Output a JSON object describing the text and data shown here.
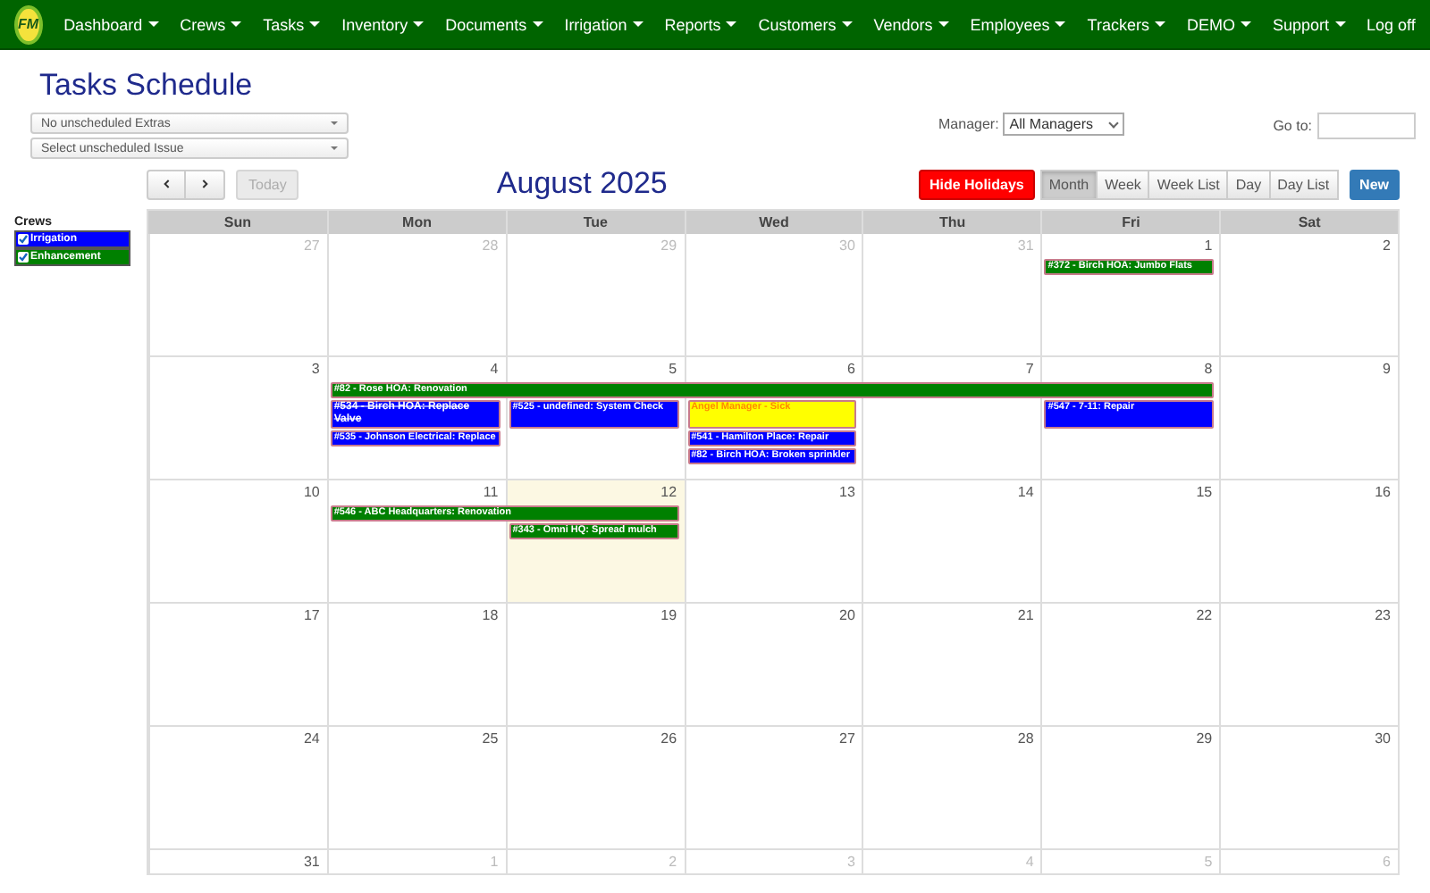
{
  "nav": {
    "logo": "FM",
    "items": [
      {
        "label": "Dashboard",
        "has_menu": true
      },
      {
        "label": "Crews",
        "has_menu": true
      },
      {
        "label": "Tasks",
        "has_menu": true
      },
      {
        "label": "Inventory",
        "has_menu": true
      },
      {
        "label": "Documents",
        "has_menu": true
      },
      {
        "label": "Irrigation",
        "has_menu": true
      },
      {
        "label": "Reports",
        "has_menu": true
      },
      {
        "label": "Customers",
        "has_menu": true
      },
      {
        "label": "Vendors",
        "has_menu": true
      },
      {
        "label": "Employees",
        "has_menu": true
      },
      {
        "label": "Trackers",
        "has_menu": true
      }
    ],
    "right_items": [
      {
        "label": "DEMO",
        "has_menu": true
      },
      {
        "label": "Support",
        "has_menu": true
      },
      {
        "label": "Log off",
        "has_menu": false
      }
    ]
  },
  "page": {
    "title": "Tasks Schedule",
    "dropdowns": [
      {
        "value": "No unscheduled Extras"
      },
      {
        "value": "Select unscheduled Issue"
      }
    ],
    "manager": {
      "label": "Manager:",
      "value": "All Managers"
    },
    "goto": {
      "label": "Go to:"
    }
  },
  "crews": {
    "title": "Crews",
    "items": [
      {
        "label": "Irrigation",
        "checked": true,
        "color": "#0000ff"
      },
      {
        "label": "Enhancement",
        "checked": true,
        "color": "#008000"
      }
    ]
  },
  "calendar": {
    "title": "August 2025",
    "today_button": {
      "label": "Today",
      "disabled": true
    },
    "hide_holidays": "Hide Holidays",
    "views": [
      {
        "label": "Month",
        "selected": true
      },
      {
        "label": "Week",
        "selected": false
      },
      {
        "label": "Week List",
        "selected": false
      },
      {
        "label": "Day",
        "selected": false
      },
      {
        "label": "Day List",
        "selected": false
      }
    ],
    "new_button": "New",
    "weekdays": [
      "Sun",
      "Mon",
      "Tue",
      "Wed",
      "Thu",
      "Fri",
      "Sat"
    ],
    "weeks": [
      {
        "days": [
          {
            "number": "27",
            "other_month": true,
            "today": false
          },
          {
            "number": "28",
            "other_month": true,
            "today": false
          },
          {
            "number": "29",
            "other_month": true,
            "today": false
          },
          {
            "number": "30",
            "other_month": true,
            "today": false
          },
          {
            "number": "31",
            "other_month": true,
            "today": false
          },
          {
            "number": "1",
            "other_month": false,
            "today": false,
            "events": [
              {
                "kind": "task",
                "text": "#372 - Birch HOA: Jumbo Flats",
                "color": "#008000",
                "completed": false
              }
            ]
          },
          {
            "number": "2",
            "other_month": false,
            "today": false
          }
        ]
      },
      {
        "days": [
          {
            "number": "3",
            "other_month": false,
            "today": false
          },
          {
            "number": "4",
            "other_month": false,
            "today": false,
            "events": [
              {
                "kind": "task",
                "text": "#82 - Rose HOA: Renovation",
                "color": "#008000",
                "completed": false
              },
              {
                "kind": "task",
                "text": "#534 - Birch HOA: Replace Valve",
                "color": "#0000ff",
                "completed": true
              },
              {
                "kind": "task",
                "text": "#535 - Johnson Electrical: Replace",
                "color": "#0000ff",
                "completed": false
              }
            ]
          },
          {
            "number": "5",
            "other_month": false,
            "today": false,
            "events": [
              {
                "kind": "continuation"
              },
              {
                "kind": "task",
                "text": "#525 - undefined: System Check",
                "color": "#0000ff",
                "completed": false
              }
            ]
          },
          {
            "number": "6",
            "other_month": false,
            "today": false,
            "events": [
              {
                "kind": "continuation"
              },
              {
                "kind": "absence",
                "text": "Angel Manager - Sick",
                "color": "#ffff00",
                "completed": false
              },
              {
                "kind": "task",
                "text": "#541 - Hamilton Place: Repair",
                "color": "#0000ff",
                "completed": false
              },
              {
                "kind": "task",
                "text": "#82 - Birch HOA: Broken sprinkler",
                "color": "#0000ff",
                "completed": false
              }
            ]
          },
          {
            "number": "7",
            "other_month": false,
            "today": false,
            "events": [
              {
                "kind": "continuation"
              }
            ]
          },
          {
            "number": "8",
            "other_month": false,
            "today": false,
            "events": [
              {
                "kind": "continuation"
              },
              {
                "kind": "task",
                "text": "#547 - 7-11: Repair",
                "color": "#0000ff",
                "completed": false
              }
            ]
          },
          {
            "number": "9",
            "other_month": false,
            "today": false
          }
        ]
      },
      {
        "days": [
          {
            "number": "10",
            "other_month": false,
            "today": false
          },
          {
            "number": "11",
            "other_month": false,
            "today": false,
            "events": [
              {
                "kind": "task",
                "text": "#546 - ABC Headquarters: Renovation",
                "color": "#008000",
                "completed": false
              }
            ]
          },
          {
            "number": "12",
            "other_month": false,
            "today": true,
            "events": [
              {
                "kind": "continuation"
              },
              {
                "kind": "task",
                "text": "#343 - Omni HQ: Spread mulch",
                "color": "#008000",
                "completed": false
              }
            ]
          },
          {
            "number": "13",
            "other_month": false,
            "today": false
          },
          {
            "number": "14",
            "other_month": false,
            "today": false
          },
          {
            "number": "15",
            "other_month": false,
            "today": false
          },
          {
            "number": "16",
            "other_month": false,
            "today": false
          }
        ]
      },
      {
        "days": [
          {
            "number": "17",
            "other_month": false,
            "today": false
          },
          {
            "number": "18",
            "other_month": false,
            "today": false
          },
          {
            "number": "19",
            "other_month": false,
            "today": false
          },
          {
            "number": "20",
            "other_month": false,
            "today": false
          },
          {
            "number": "21",
            "other_month": false,
            "today": false
          },
          {
            "number": "22",
            "other_month": false,
            "today": false
          },
          {
            "number": "23",
            "other_month": false,
            "today": false
          }
        ]
      },
      {
        "days": [
          {
            "number": "24",
            "other_month": false,
            "today": false
          },
          {
            "number": "25",
            "other_month": false,
            "today": false
          },
          {
            "number": "26",
            "other_month": false,
            "today": false
          },
          {
            "number": "27",
            "other_month": false,
            "today": false
          },
          {
            "number": "28",
            "other_month": false,
            "today": false
          },
          {
            "number": "29",
            "other_month": false,
            "today": false
          },
          {
            "number": "30",
            "other_month": false,
            "today": false
          }
        ]
      },
      {
        "days": [
          {
            "number": "31",
            "other_month": false,
            "today": false
          },
          {
            "number": "1",
            "other_month": true,
            "today": false
          },
          {
            "number": "2",
            "other_month": true,
            "today": false
          },
          {
            "number": "3",
            "other_month": true,
            "today": false
          },
          {
            "number": "4",
            "other_month": true,
            "today": false
          },
          {
            "number": "5",
            "other_month": true,
            "today": false
          },
          {
            "number": "6",
            "other_month": true,
            "today": false
          }
        ]
      }
    ]
  }
}
